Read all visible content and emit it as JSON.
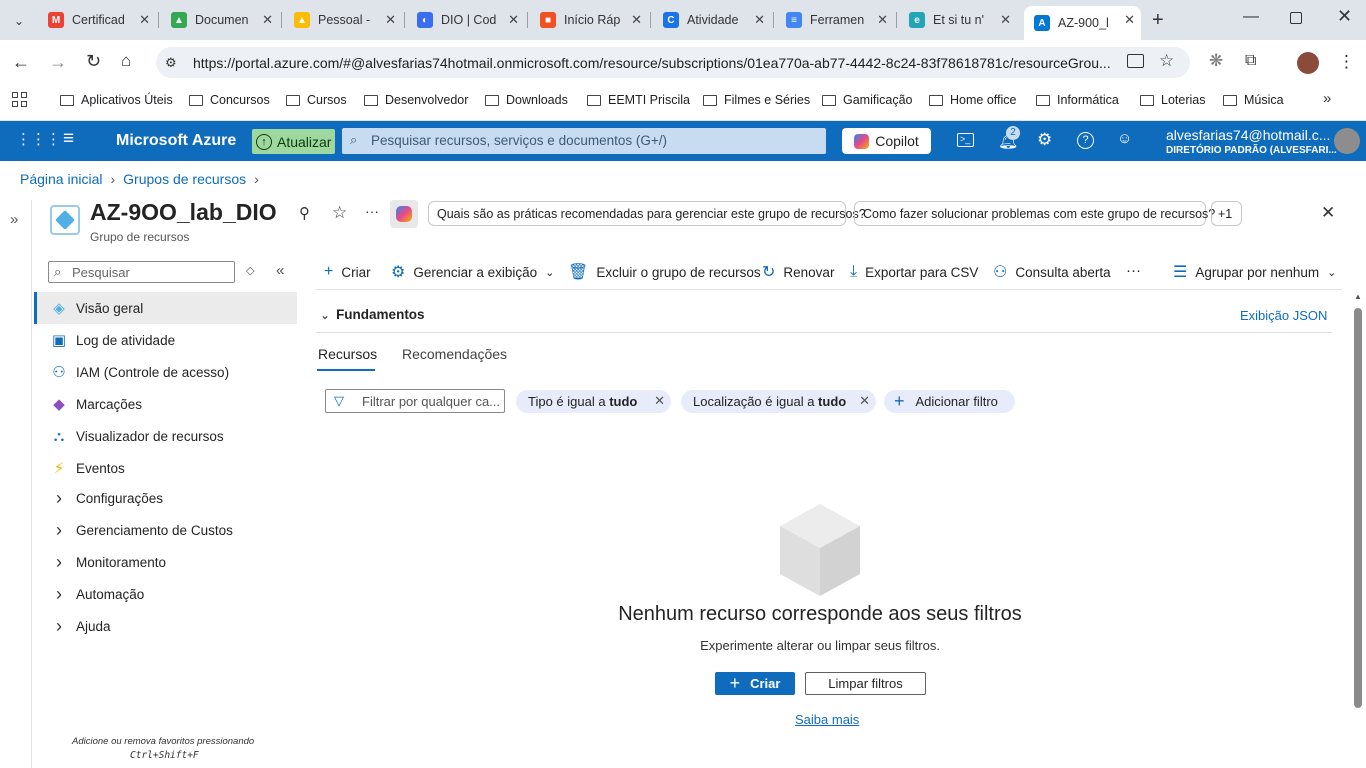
{
  "browser": {
    "tabs": [
      {
        "title": "Certificad",
        "icon": "gmail-icon",
        "color": "#ea4335",
        "glyph": "M"
      },
      {
        "title": "Documen",
        "icon": "drive-icon",
        "color": "#34a853",
        "glyph": "▲"
      },
      {
        "title": "Pessoal - ",
        "icon": "drive-icon",
        "color": "#fbbc04",
        "glyph": "▲"
      },
      {
        "title": "DIO | Cod",
        "icon": "dio-icon",
        "color": "#3a6df0",
        "glyph": "◐"
      },
      {
        "title": "Início Ráp",
        "icon": "microsoft-icon",
        "color": "#f25022",
        "glyph": "■"
      },
      {
        "title": "Atividade",
        "icon": "classroom-icon",
        "color": "#1a73e8",
        "glyph": "C"
      },
      {
        "title": "Ferramen",
        "icon": "docs-icon",
        "color": "#4285f4",
        "glyph": "≡"
      },
      {
        "title": "Et si tu n'",
        "icon": "edge-icon",
        "color": "#22a6b3",
        "glyph": "e"
      },
      {
        "title": "AZ-900_l",
        "icon": "azure-icon",
        "color": "#0078d4",
        "glyph": "A",
        "active": true
      }
    ],
    "url": "https://portal.azure.com/#@alvesfarias74hotmail.onmicrosoft.com/resource/subscriptions/01ea770a-ab77-4442-8c24-83f78618781c/resourceGrou...",
    "bookmarks": [
      "Aplicativos Úteis",
      "Concursos",
      "Cursos",
      "Desenvolvedor",
      "Downloads",
      "EEMTI Priscila",
      "Filmes e Séries",
      "Gamificação",
      "Home office",
      "Informática",
      "Loterias",
      "Música"
    ]
  },
  "azure": {
    "brand": "Microsoft Azure",
    "update_label": "Atualizar",
    "search_placeholder": "Pesquisar recursos, serviços e documentos (G+/)",
    "copilot_label": "Copilot",
    "notifications_count": "2",
    "account_email": "alvesfarias74@hotmail.c...",
    "account_directory": "DIRETÓRIO PADRÃO (ALVESFARI..."
  },
  "breadcrumb": [
    "Página inicial",
    "Grupos de recursos"
  ],
  "resource": {
    "title": "AZ-9OO_lab_DIO",
    "subtitle": "Grupo de recursos",
    "suggestions": [
      "Quais são as práticas recomendadas para gerenciar este grupo de recursos?",
      "Como fazer solucionar problemas com este grupo de recursos?"
    ],
    "more_suggestions": "+1"
  },
  "sidebar": {
    "search_placeholder": "Pesquisar",
    "items": [
      {
        "label": "Visão geral",
        "icon": "resource-group-icon",
        "selected": true
      },
      {
        "label": "Log de atividade",
        "icon": "activity-log-icon"
      },
      {
        "label": "IAM (Controle de acesso)",
        "icon": "iam-icon"
      },
      {
        "label": "Marcações",
        "icon": "tag-icon"
      },
      {
        "label": "Visualizador de recursos",
        "icon": "resource-visualizer-icon"
      },
      {
        "label": "Eventos",
        "icon": "events-icon"
      },
      {
        "label": "Configurações",
        "expandable": true
      },
      {
        "label": "Gerenciamento de Custos",
        "expandable": true
      },
      {
        "label": "Monitoramento",
        "expandable": true
      },
      {
        "label": "Automação",
        "expandable": true
      },
      {
        "label": "Ajuda",
        "expandable": true
      }
    ],
    "footer_line1": "Adicione ou remova favoritos pressionando",
    "footer_line2": "Ctrl+Shift+F"
  },
  "commands": {
    "create": "Criar",
    "manage_view": "Gerenciar a exibição",
    "delete_group": "Excluir o grupo de recursos",
    "refresh": "Renovar",
    "export_csv": "Exportar para CSV",
    "open_query": "Consulta aberta",
    "group_by": "Agrupar por nenhum"
  },
  "essentials": {
    "label": "Fundamentos",
    "json_view": "Exibição JSON"
  },
  "tabs": [
    "Recursos",
    "Recomendações"
  ],
  "filters": {
    "placeholder": "Filtrar por qualquer ca...",
    "type_prefix": "Tipo é igual a",
    "type_value": "tudo",
    "location_prefix": "Localização é igual a",
    "location_value": "tudo",
    "add_filter": "Adicionar filtro"
  },
  "empty_state": {
    "title": "Nenhum recurso corresponde aos seus filtros",
    "subtitle": "Experimente alterar ou limpar seus filtros.",
    "create_label": "Criar",
    "clear_label": "Limpar filtros",
    "learn_more": "Saiba mais"
  },
  "colors": {
    "azure_blue": "#0f6cbd",
    "update_green": "#9fd89f"
  }
}
